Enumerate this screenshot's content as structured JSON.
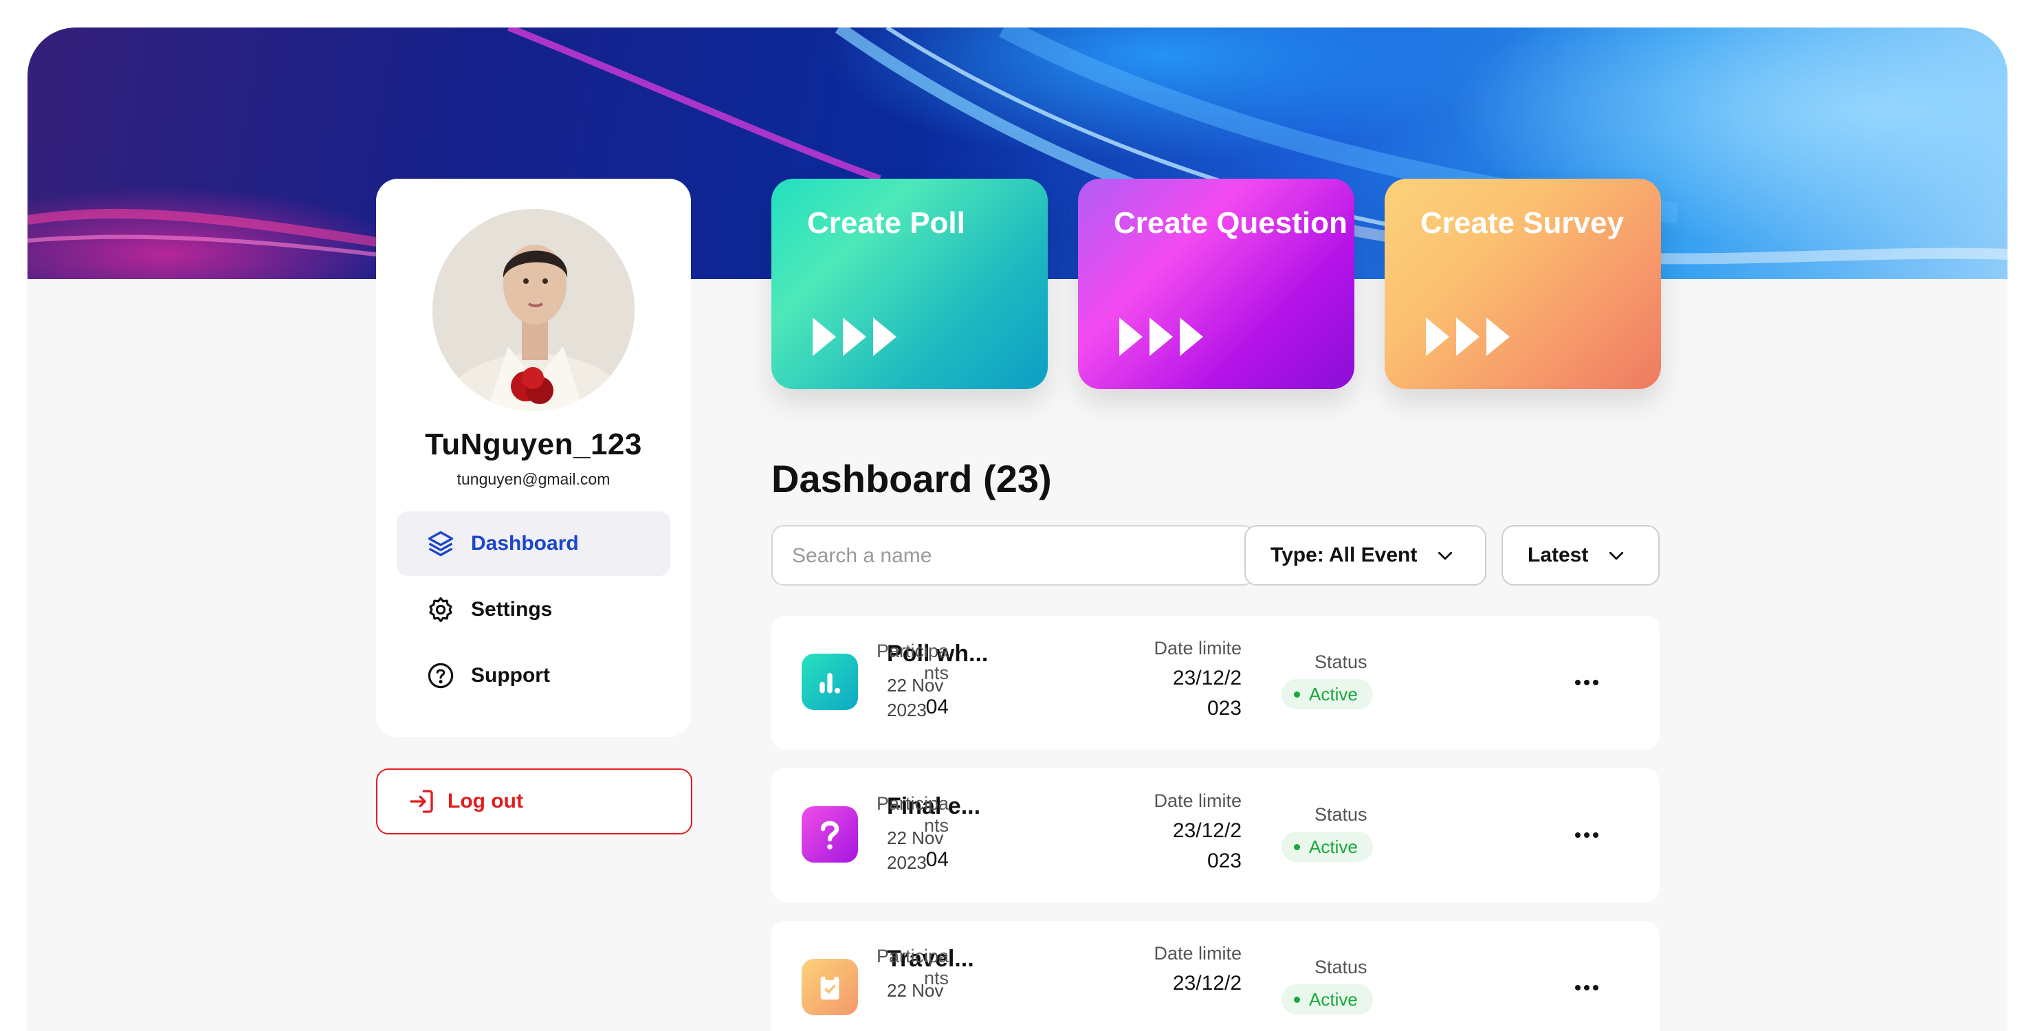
{
  "profile": {
    "username": "TuNguyen_123",
    "email": "tunguyen@gmail.com"
  },
  "nav": {
    "items": [
      {
        "label": "Dashboard",
        "icon": "layers-icon",
        "active": true
      },
      {
        "label": "Settings",
        "icon": "gear-icon",
        "active": false
      },
      {
        "label": "Support",
        "icon": "help-circle-icon",
        "active": false
      }
    ],
    "logout_label": "Log out"
  },
  "create_cards": [
    {
      "title": "Create Poll"
    },
    {
      "title": "Create Question"
    },
    {
      "title": "Create Survey"
    }
  ],
  "dashboard": {
    "title": "Dashboard (23)",
    "search_placeholder": "Search a name",
    "type_filter": "Type: All Event",
    "sort": "Latest"
  },
  "events": [
    {
      "name": "Poll wh...",
      "date_line1": "22 Nov",
      "date_line2": "2023",
      "participants_h1": "Participa",
      "participants_h2": "nts",
      "participants": "04",
      "date_limit_label": "Date limite",
      "date_limit_1": "23/12/2",
      "date_limit_2": "023",
      "status_label": "Status",
      "status": "Active",
      "type_icon": "bar-chart-icon"
    },
    {
      "name": "Final e...",
      "date_line1": "22 Nov",
      "date_line2": "2023",
      "participants_h1": "Participa",
      "participants_h2": "nts",
      "participants": "04",
      "date_limit_label": "Date limite",
      "date_limit_1": "23/12/2",
      "date_limit_2": "023",
      "status_label": "Status",
      "status": "Active",
      "type_icon": "question-mark-icon"
    },
    {
      "name": "Travel...",
      "date_line1": "22 Nov",
      "date_line2": "",
      "participants_h1": "Participa",
      "participants_h2": "nts",
      "participants": "",
      "date_limit_label": "Date limite",
      "date_limit_1": "23/12/2",
      "date_limit_2": "",
      "status_label": "Status",
      "status": "Active",
      "type_icon": "clipboard-check-icon"
    }
  ],
  "colors": {
    "accent_blue": "#1a46c8",
    "logout_red": "#e01c1c",
    "active_green": "#19a83c"
  }
}
